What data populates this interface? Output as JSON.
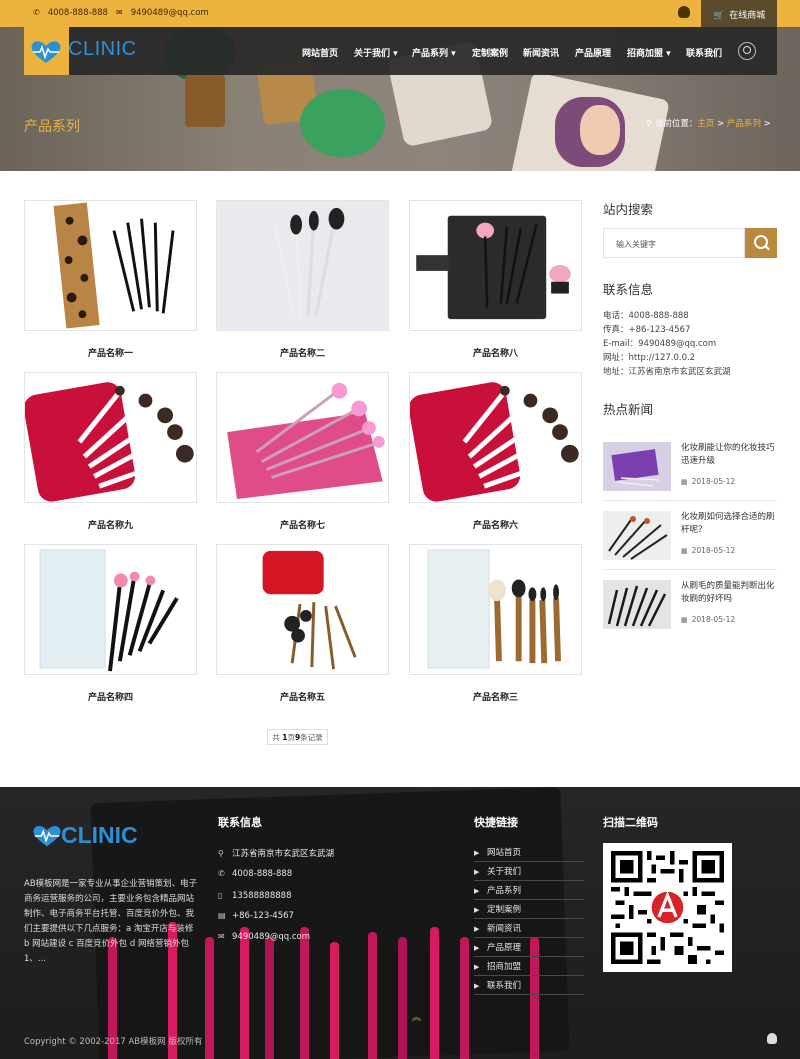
{
  "topbar": {
    "phone": "4008-888-888",
    "email": "9490489@qq.com",
    "mall_label": "在线商城"
  },
  "brand": {
    "logo_text": "CLINIC",
    "accent_color": "#ecb33f",
    "logo_color": "#2d8fd4"
  },
  "nav": {
    "items": [
      {
        "label": "网站首页"
      },
      {
        "label": "关于我们 ▾"
      },
      {
        "label": "产品系列 ▾"
      },
      {
        "label": "定制案例"
      },
      {
        "label": "新闻资讯"
      },
      {
        "label": "产品原理"
      },
      {
        "label": "招商加盟 ▾"
      },
      {
        "label": "联系我们"
      }
    ]
  },
  "banner": {
    "title": "产品系列",
    "crumb_prefix": "当前位置：",
    "crumb_home": "主页",
    "crumb_sep": " > ",
    "crumb_current": "产品系列",
    "crumb_tail": " >"
  },
  "products": [
    {
      "name": "产品名称一"
    },
    {
      "name": "产品名称二"
    },
    {
      "name": "产品名称八"
    },
    {
      "name": "产品名称九"
    },
    {
      "name": "产品名称七"
    },
    {
      "name": "产品名称六"
    },
    {
      "name": "产品名称四"
    },
    {
      "name": "产品名称五"
    },
    {
      "name": "产品名称三"
    }
  ],
  "pager": {
    "prefix": "共 ",
    "pages": "1",
    "mid": "页",
    "records": "9",
    "suffix": "条记录"
  },
  "sidebar": {
    "search_title": "站内搜索",
    "search_placeholder": "输入关键字",
    "contact_title": "联系信息",
    "contact_lines": [
      "电话：4008-888-888",
      "传真：+86-123-4567",
      "E-mail：9490489@qq.com",
      "网址：http://127.0.0.2",
      "地址：江苏省南京市玄武区玄武湖"
    ],
    "news_title": "热点新闻",
    "news": [
      {
        "title": "化妆刷能让你的化妆技巧迅速升级",
        "date": "2018-05-12"
      },
      {
        "title": "化妆刷如何选择合适的刷杆呢？",
        "date": "2018-05-12"
      },
      {
        "title": "从刷毛的质量能判断出化妆刷的好坏吗",
        "date": "2018-05-12"
      }
    ]
  },
  "footer": {
    "about": "AB模板网是一家专业从事企业营销策划、电子商务运营服务的公司，主要业务包含精品网站制作、电子商务平台托管、百度竞价外包、我们主要提供以下几点服务：a 淘宝开店与装修 b 网站建设 c 百度竞价外包 d 网络营销外包 1、...",
    "contact_title": "联系信息",
    "contact": [
      {
        "icon": "map-pin-icon",
        "text": "江苏省南京市玄武区玄武湖"
      },
      {
        "icon": "phone-icon",
        "text": "4008-888-888"
      },
      {
        "icon": "mobile-icon",
        "text": "13588888888"
      },
      {
        "icon": "fax-icon",
        "text": "+86-123-4567"
      },
      {
        "icon": "mail-icon",
        "text": "9490489@qq.com"
      }
    ],
    "links_title": "快捷链接",
    "links": [
      "网站首页",
      "关于我们",
      "产品系列",
      "定制案例",
      "新闻资讯",
      "产品原理",
      "招商加盟",
      "联系我们"
    ],
    "qr_title": "扫描二维码",
    "copyright": "Copyright © 2002-2017 AB模板网 版权所有"
  }
}
